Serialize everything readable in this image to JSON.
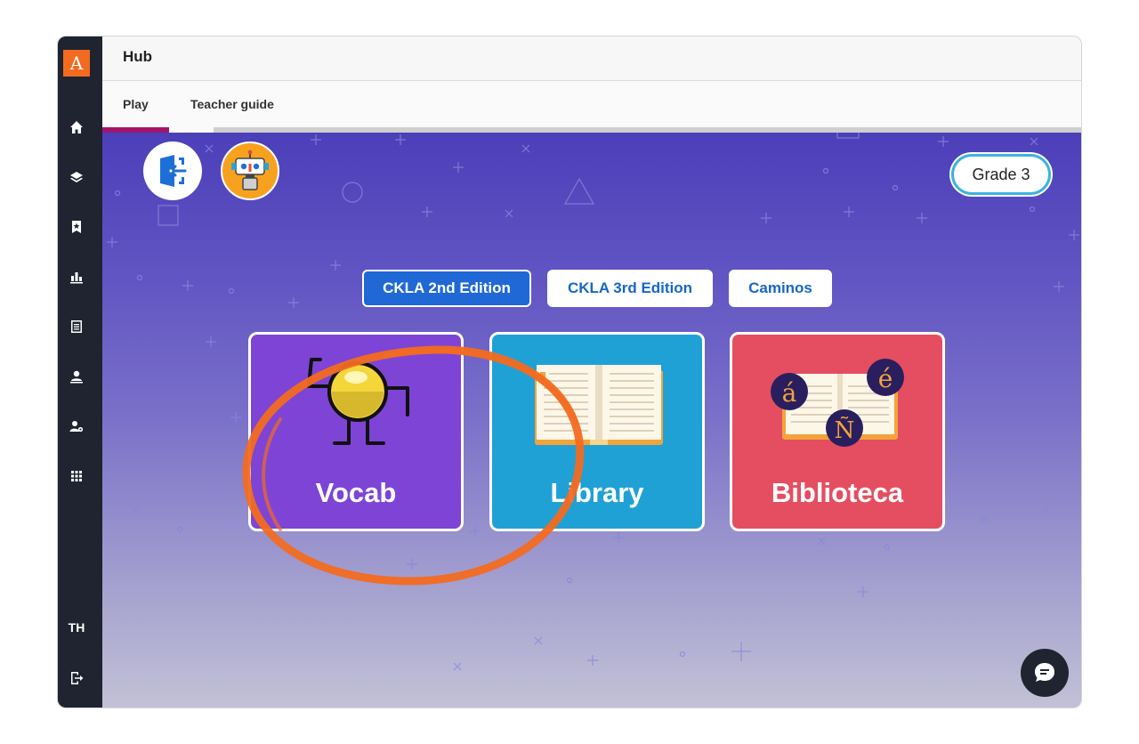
{
  "app": {
    "logo_letter": "A",
    "header_title": "Hub",
    "user_initials": "TH"
  },
  "rail": {
    "icons": [
      "home-icon",
      "layers-icon",
      "bookmark-star-icon",
      "bar-chart-icon",
      "document-icon",
      "teacher-icon",
      "user-settings-icon",
      "apps-grid-icon",
      "sign-out-icon"
    ]
  },
  "tabs": [
    {
      "label": "Play",
      "active": true
    },
    {
      "label": "Teacher guide",
      "active": false
    }
  ],
  "stage": {
    "grade_label": "Grade 3",
    "editions": [
      {
        "label": "CKLA 2nd Edition",
        "active": true
      },
      {
        "label": "CKLA 3rd Edition",
        "active": false
      },
      {
        "label": "Caminos",
        "active": false
      }
    ],
    "cards": [
      {
        "label": "Vocab",
        "color": "#7d44d6"
      },
      {
        "label": "Library",
        "color": "#20a1d5"
      },
      {
        "label": "Biblioteca",
        "color": "#e54e60",
        "badges": [
          "á",
          "é",
          "Ñ"
        ]
      }
    ]
  },
  "colors": {
    "accent_orange": "#f26b21",
    "tab_underline": "#a3156c",
    "edition_active": "#1f68d6",
    "rail_bg": "#1f2430"
  }
}
